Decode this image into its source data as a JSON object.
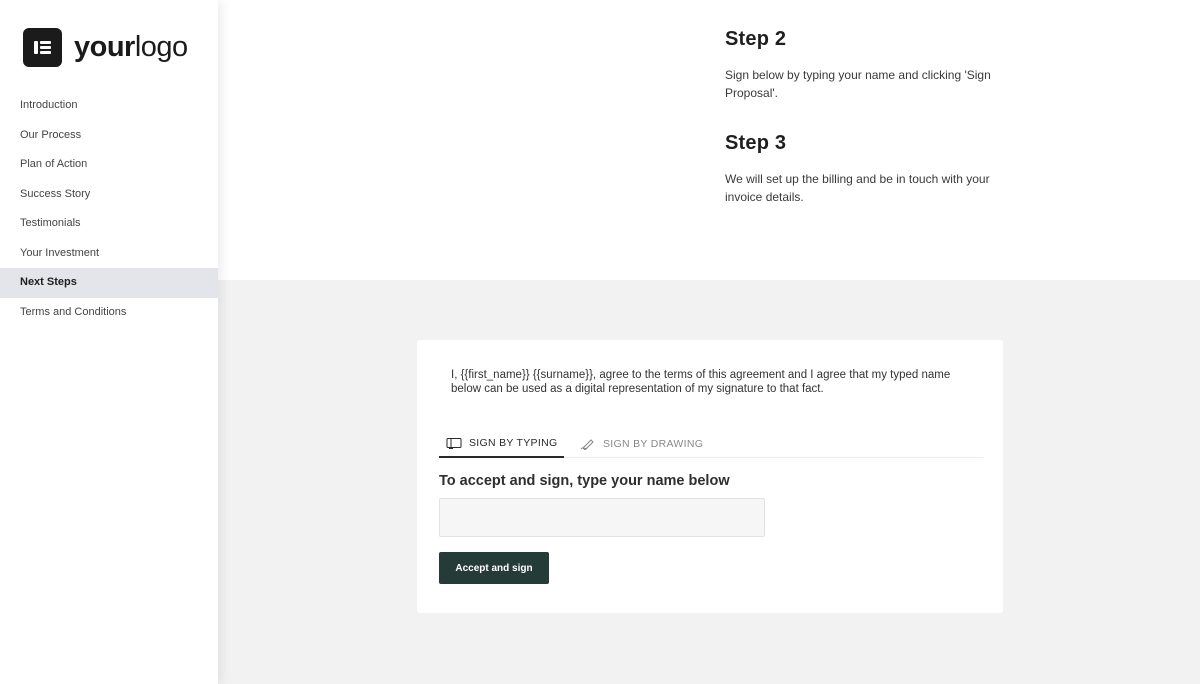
{
  "logo": {
    "mark": "elementor-logo-icon",
    "text_bold": "your",
    "text_regular": "logo"
  },
  "sidebar": {
    "items": [
      {
        "label": "Introduction",
        "active": false
      },
      {
        "label": "Our Process",
        "active": false
      },
      {
        "label": "Plan of Action",
        "active": false
      },
      {
        "label": "Success Story",
        "active": false
      },
      {
        "label": "Testimonials",
        "active": false
      },
      {
        "label": "Your Investment",
        "active": false
      },
      {
        "label": "Next Steps",
        "active": true
      },
      {
        "label": "Terms and Conditions",
        "active": false
      }
    ]
  },
  "steps": [
    {
      "title": "Step 2",
      "text": "Sign below by typing your name and clicking 'Sign Proposal'."
    },
    {
      "title": "Step 3",
      "text": "We will set up the billing and be in touch with your invoice details."
    }
  ],
  "signature": {
    "agreement": "I, {{first_name}} {{surname}}, agree to the terms of this agreement and I agree that my typed name below can be used as a digital representation of my signature to that fact.",
    "tabs": [
      {
        "label": "SIGN BY TYPING",
        "icon": "keyboard-icon",
        "active": true
      },
      {
        "label": "SIGN BY DRAWING",
        "icon": "pen-icon",
        "active": false
      }
    ],
    "title": "To accept and sign, type your name below",
    "input_value": "",
    "input_placeholder": "",
    "button_label": "Accept and sign"
  },
  "colors": {
    "button_bg": "#243b37",
    "active_nav_bg": "#e3e5ea",
    "page_bg_lower": "#f2f2f2"
  }
}
